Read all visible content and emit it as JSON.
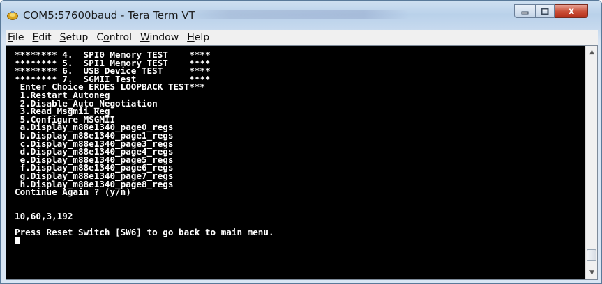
{
  "window": {
    "title": "COM5:57600baud - Tera Term VT",
    "controls": {
      "minimize_icon": "minimize-icon",
      "maximize_icon": "maximize-icon",
      "close_icon": "close-icon",
      "close_glyph": "x"
    }
  },
  "menu": [
    {
      "mnemonic": "F",
      "rest": "ile"
    },
    {
      "mnemonic": "E",
      "rest": "dit"
    },
    {
      "mnemonic": "S",
      "rest": "etup"
    },
    {
      "prefix": "C",
      "mnemonic": "o",
      "rest": "ntrol"
    },
    {
      "mnemonic": "W",
      "rest": "indow"
    },
    {
      "mnemonic": "H",
      "rest": "elp"
    }
  ],
  "terminal": {
    "lines": [
      "******** 4.  SPI0 Memory TEST    ****",
      "******** 5.  SPI1 Memory TEST    ****",
      "******** 6.  USB Device TEST     ****",
      "******** 7.  SGMII Test          ****",
      " Enter Choice ERDES LOOPBACK TEST***",
      " 1.Restart_Autoneg",
      " 2.Disable_Auto_Negotiation",
      " 3.Read_Msgmii_Reg",
      " 5.Configure MSGMII",
      " a.Display_m88e1340_page0_regs",
      " b.Display_m88e1340_page1_regs",
      " c.Display_m88e1340_page3_regs",
      " d.Display_m88e1340_page4_regs",
      " e.Display_m88e1340_page5_regs",
      " f.Display_m88e1340_page6_regs",
      " g.Display_m88e1340_page7_regs",
      " h.Display_m88e1340_page8_regs",
      "Continue Again ? (y/n)",
      "",
      "",
      "10,60,3,192",
      "",
      "Press Reset Switch [SW6] to go back to main menu."
    ]
  },
  "scrollbar": {
    "up_arrow": "▲",
    "down_arrow": "▼",
    "position": 0.97
  },
  "colors": {
    "terminal_bg": "#000000",
    "terminal_fg": "#ffffff",
    "close_button": "#c94d35"
  }
}
